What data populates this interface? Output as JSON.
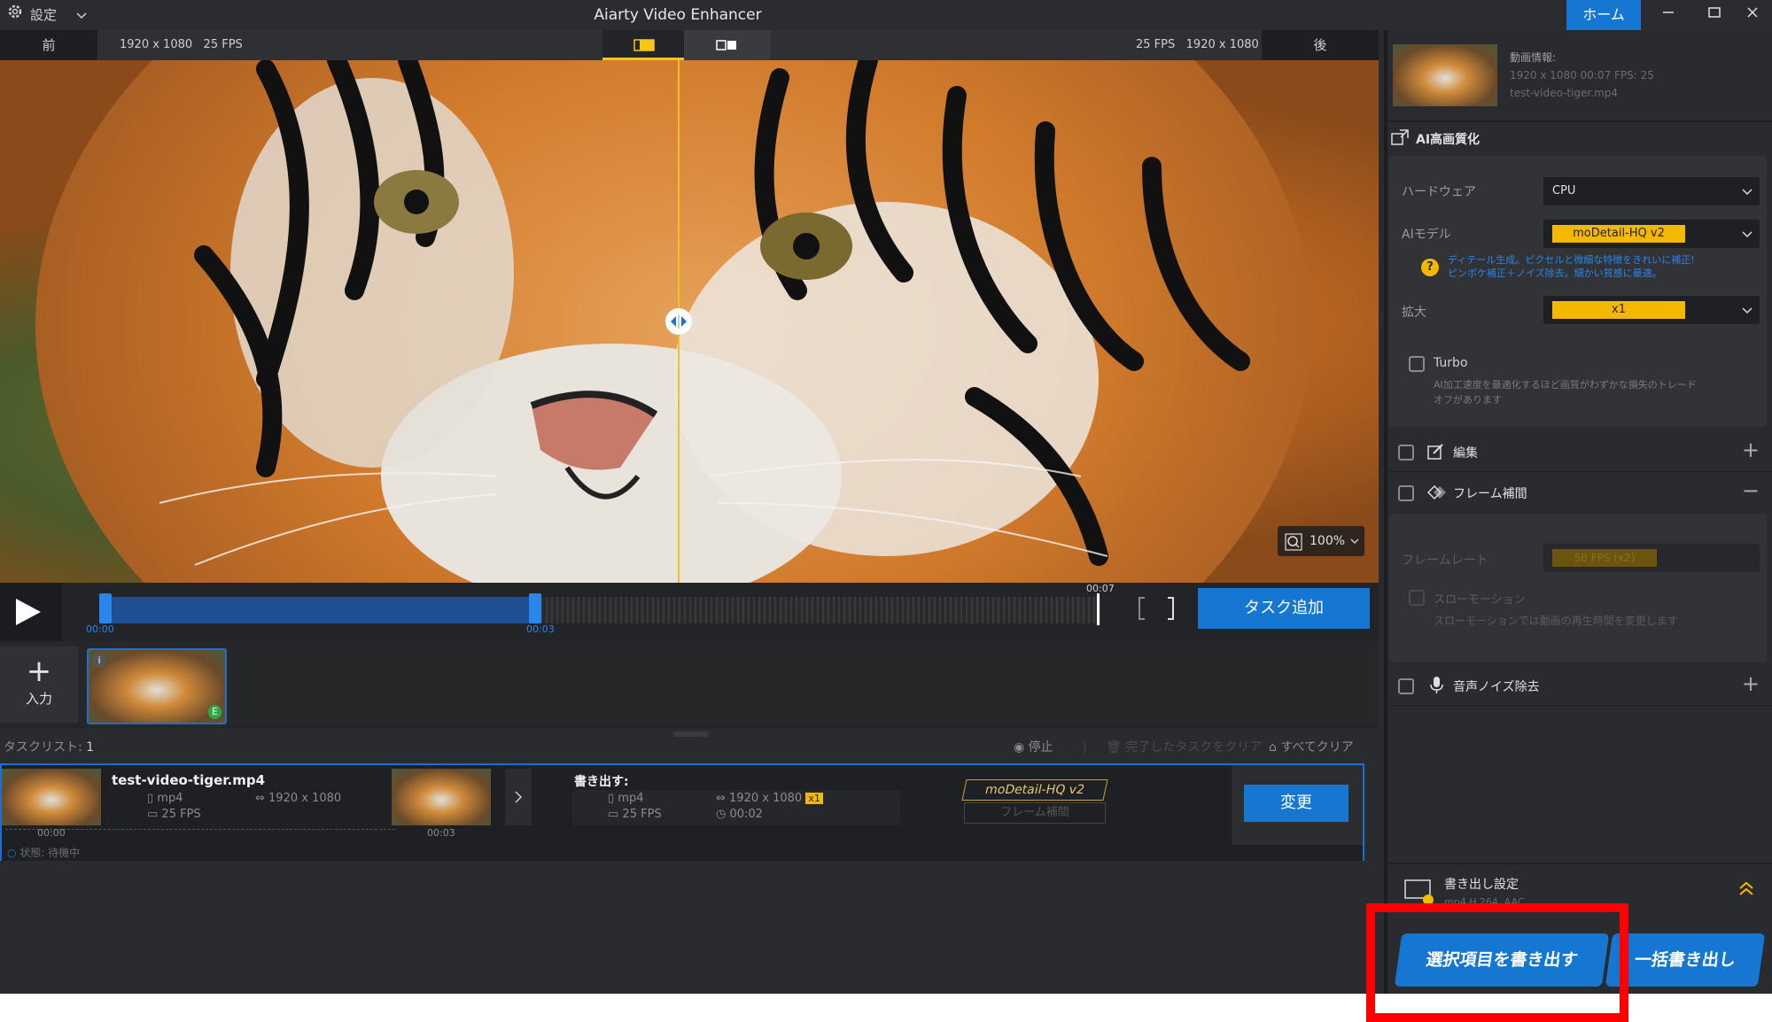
{
  "titlebar": {
    "settings_label": "設定",
    "app_title": "Aiarty Video Enhancer",
    "home_label": "ホーム"
  },
  "preview": {
    "before_label": "前",
    "after_label": "後",
    "left_resolution": "1920 x 1080",
    "left_fps": "25 FPS",
    "right_fps": "25 FPS",
    "right_resolution": "1920 x 1080",
    "zoom_level": "100%"
  },
  "timeline": {
    "start_time": "00:00",
    "mark_time": "00:03",
    "end_time": "00:07",
    "task_add_label": "タスク追加"
  },
  "import": {
    "input_label": "入力",
    "thumb_badge": "E"
  },
  "tasklist": {
    "title": "タスクリスト:",
    "count": "1",
    "stop_label": "停止",
    "clear_done_label": "完了したタスクをクリア",
    "clear_all_label": "すべてクリア"
  },
  "task": {
    "filename": "test-video-tiger.mp4",
    "format": "mp4",
    "fps": "25 FPS",
    "resolution": "1920 x 1080",
    "thumb_start": "00:00",
    "thumb_end": "00:03",
    "export_label": "書き出す:",
    "out_format": "mp4",
    "out_fps": "25 FPS",
    "out_resolution": "1920 x 1080",
    "out_scale_badge": "x1",
    "out_duration": "00:02",
    "model_tag": "moDetail-HQ v2",
    "frame_tag": "フレーム補間",
    "change_label": "変更",
    "status": "状態: 待機中"
  },
  "rightpanel": {
    "video_info_label": "動画情報:",
    "video_info_line1": "1920 x 1080  00:07    FPS: 25",
    "video_info_file": "test-video-tiger.mp4",
    "ai_section_title": "AI高画質化",
    "hardware_label": "ハードウェア",
    "hardware_value": "CPU",
    "ai_model_label": "AIモデル",
    "ai_model_value": "moDetail-HQ  v2",
    "model_desc_line1": "ディテール生成。ピクセルと微細な特徴をきれいに補正!",
    "model_desc_line2": "ピンボケ補正＋ノイズ除去。細かい質感に最適。",
    "scale_label": "拡大",
    "scale_value": "x1",
    "turbo_label": "Turbo",
    "turbo_desc_line1": "AI加工速度を最適化するほど画質がわずかな損失のトレード",
    "turbo_desc_line2": "オフがあります",
    "edit_label": "編集",
    "frame_interp_label": "フレーム補間",
    "frame_rate_label": "フレームレート",
    "frame_rate_value": "50 FPS (x2)",
    "slowmo_label": "スローモーション",
    "slowmo_desc": "スローモーションでは動画の再生時間を変更します",
    "audio_denoise_label": "音声ノイズ除去",
    "export_settings_label": "書き出し設定",
    "export_settings_sub": "mp4 H.264, AAC",
    "export_selected_label": "選択項目を書き出す",
    "export_all_label": "一括書き出し"
  },
  "colors": {
    "accent_blue": "#1677d2",
    "accent_yellow": "#f5b800",
    "highlight_red": "#ff0000"
  }
}
